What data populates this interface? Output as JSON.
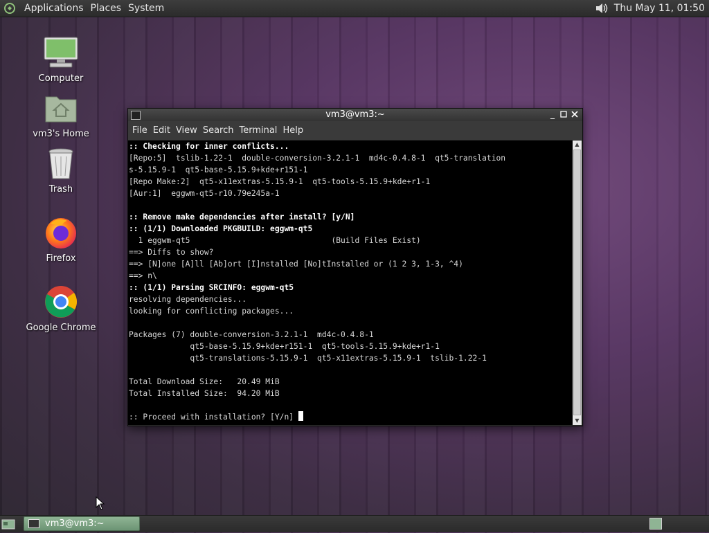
{
  "top_panel": {
    "menus": [
      "Applications",
      "Places",
      "System"
    ],
    "clock": "Thu May 11, 01:50",
    "icons": {
      "logo": "distro-logo-icon",
      "volume": "volume-icon"
    }
  },
  "desktop_icons": [
    {
      "label": "Computer",
      "icon": "computer-icon"
    },
    {
      "label": "vm3's Home",
      "icon": "home-folder-icon"
    },
    {
      "label": "Trash",
      "icon": "trash-icon"
    },
    {
      "label": "Firefox",
      "icon": "firefox-icon"
    },
    {
      "label": "Google Chrome",
      "icon": "chrome-icon"
    }
  ],
  "terminal": {
    "title": "vm3@vm3:~",
    "menus": [
      "File",
      "Edit",
      "View",
      "Search",
      "Terminal",
      "Help"
    ],
    "lines": [
      {
        "text": ":: Checking for inner conflicts...",
        "bold": true
      },
      {
        "text": "[Repo:5]  tslib-1.22-1  double-conversion-3.2.1-1  md4c-0.4.8-1  qt5-translation",
        "bold": false
      },
      {
        "text": "s-5.15.9-1  qt5-base-5.15.9+kde+r151-1",
        "bold": false
      },
      {
        "text": "[Repo Make:2]  qt5-x11extras-5.15.9-1  qt5-tools-5.15.9+kde+r1-1",
        "bold": false
      },
      {
        "text": "[Aur:1]  eggwm-qt5-r10.79e245a-1",
        "bold": false
      },
      {
        "text": "",
        "bold": false
      },
      {
        "text": ":: Remove make dependencies after install? [y/N]",
        "bold": true
      },
      {
        "text": ":: (1/1) Downloaded PKGBUILD: eggwm-qt5",
        "bold": true
      },
      {
        "text": "  1 eggwm-qt5                              (Build Files Exist)",
        "bold": false
      },
      {
        "text": "==> Diffs to show?",
        "bold": false
      },
      {
        "text": "==> [N]one [A]ll [Ab]ort [I]nstalled [No]tInstalled or (1 2 3, 1-3, ^4)",
        "bold": false
      },
      {
        "text": "==> n\\",
        "bold": false
      },
      {
        "text": ":: (1/1) Parsing SRCINFO: eggwm-qt5",
        "bold": true
      },
      {
        "text": "resolving dependencies...",
        "bold": false
      },
      {
        "text": "looking for conflicting packages...",
        "bold": false
      },
      {
        "text": "",
        "bold": false
      },
      {
        "text": "Packages (7) double-conversion-3.2.1-1  md4c-0.4.8-1",
        "bold": false
      },
      {
        "text": "             qt5-base-5.15.9+kde+r151-1  qt5-tools-5.15.9+kde+r1-1",
        "bold": false
      },
      {
        "text": "             qt5-translations-5.15.9-1  qt5-x11extras-5.15.9-1  tslib-1.22-1",
        "bold": false
      },
      {
        "text": "",
        "bold": false
      },
      {
        "text": "Total Download Size:   20.49 MiB",
        "bold": false
      },
      {
        "text": "Total Installed Size:  94.20 MiB",
        "bold": false
      },
      {
        "text": "",
        "bold": false
      },
      {
        "text": ":: Proceed with installation? [Y/n] ",
        "bold": false
      }
    ]
  },
  "bottom_panel": {
    "task_label": "vm3@vm3:~"
  },
  "colors": {
    "accent": "#7aa47f",
    "terminal_bg": "#000000",
    "terminal_fg": "#d8d8d8"
  }
}
